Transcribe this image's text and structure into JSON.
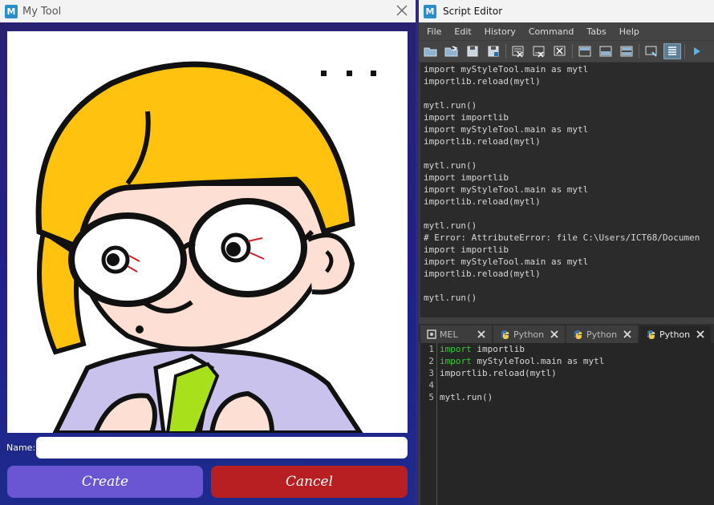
{
  "my_tool": {
    "title": "My Tool",
    "icon_letter": "M",
    "name_label": "Name:",
    "name_value": "",
    "create_label": "Create",
    "cancel_label": "Cancel",
    "colors": {
      "create": "#6a55d3",
      "cancel": "#b81f23",
      "background": "#21208a"
    }
  },
  "script_editor": {
    "title": "Script Editor",
    "icon_letter": "M",
    "menu": [
      "File",
      "Edit",
      "History",
      "Command",
      "Tabs",
      "Help"
    ],
    "toolbar_icons": [
      "open-script-icon",
      "source-script-icon",
      "save-script-icon",
      "save-script-to-shelf-icon",
      "clear-history-icon",
      "clear-input-icon",
      "clear-all-icon",
      "show-history-icon",
      "show-input-icon",
      "show-both-icon",
      "echo-all-commands-icon",
      "show-line-numbers-icon",
      "execute-icon"
    ],
    "history_text": "import myStyleTool.main as mytl\nimportlib.reload(mytl)\n\nmytl.run()\nimport importlib\nimport myStyleTool.main as mytl\nimportlib.reload(mytl)\n\nmytl.run()\nimport importlib\nimport myStyleTool.main as mytl\nimportlib.reload(mytl)\n\nmytl.run()\n# Error: AttributeError: file C:\\Users/ICT68/Documen\nimport importlib\nimport myStyleTool.main as mytl\nimportlib.reload(mytl)\n\nmytl.run()",
    "tabs": [
      {
        "label": "MEL",
        "icon": "mel-icon"
      },
      {
        "label": "Python",
        "icon": "python-icon"
      },
      {
        "label": "Python",
        "icon": "python-icon"
      },
      {
        "label": "Python",
        "icon": "python-icon",
        "active": true
      }
    ],
    "code_lines": [
      {
        "num": "1",
        "keyword": "import",
        "rest": " importlib"
      },
      {
        "num": "2",
        "keyword": "import",
        "rest": " myStyleTool.main as mytl"
      },
      {
        "num": "3",
        "keyword": "",
        "rest": "importlib.reload(mytl)"
      },
      {
        "num": "4",
        "keyword": "",
        "rest": ""
      },
      {
        "num": "5",
        "keyword": "",
        "rest": "mytl.run()"
      }
    ]
  }
}
